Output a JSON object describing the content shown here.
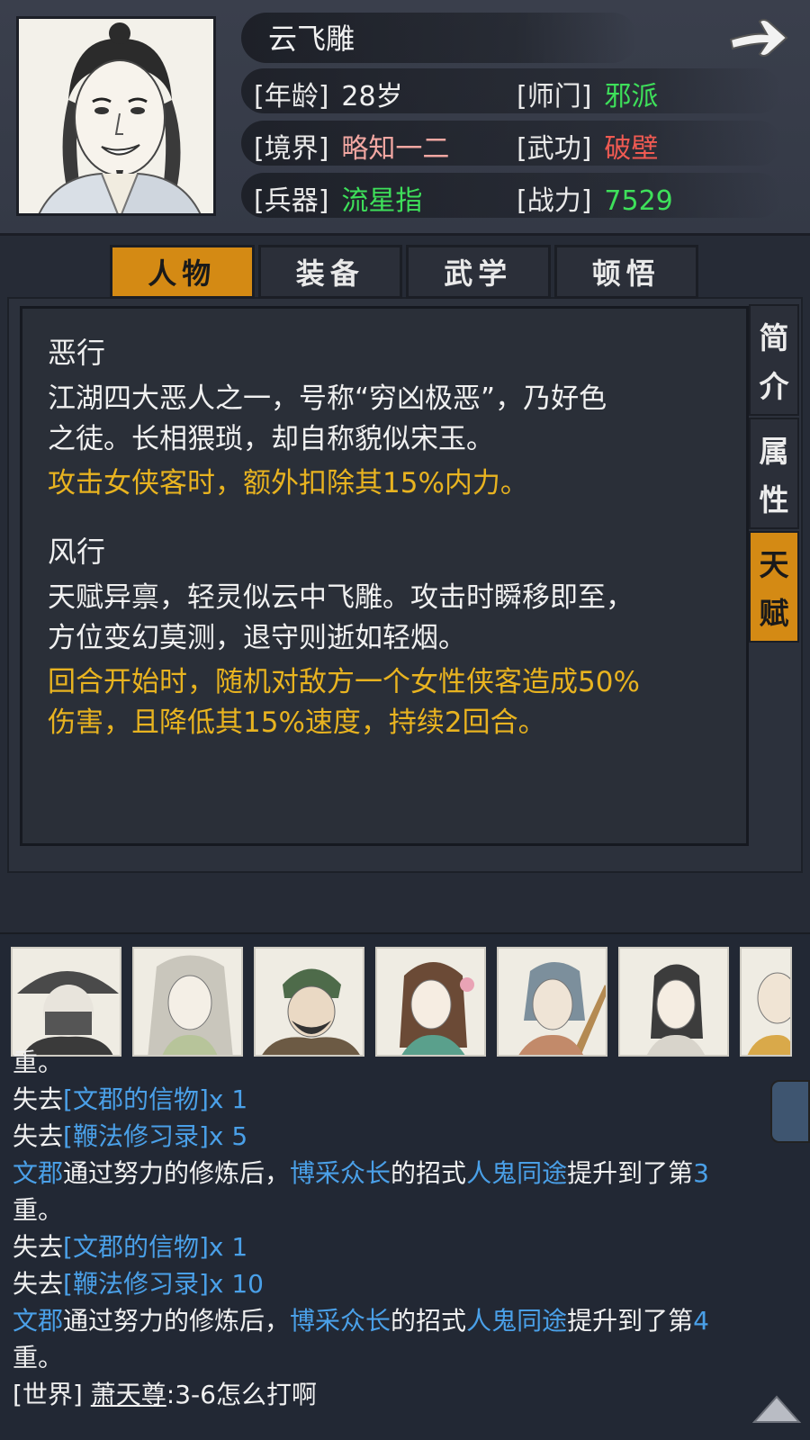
{
  "character": {
    "name": "云飞雕",
    "stats": [
      {
        "label": "[年龄]",
        "value": "28岁",
        "color": "#f0f0f0"
      },
      {
        "label": "[师门]",
        "value": "邪派",
        "color": "#3ee05a"
      },
      {
        "label": "[境界]",
        "value": "略知一二",
        "color": "#f2a7a2"
      },
      {
        "label": "[武功]",
        "value": "破壁",
        "color": "#f05a52"
      },
      {
        "label": "[兵器]",
        "value": "流星指",
        "color": "#3ee05a"
      },
      {
        "label": "[战力]",
        "value": "7529",
        "color": "#3ee05a"
      }
    ]
  },
  "tabs": [
    "人物",
    "装备",
    "武学",
    "顿悟"
  ],
  "side_tabs": [
    {
      "chars": [
        "简",
        "介"
      ]
    },
    {
      "chars": [
        "属",
        "性"
      ]
    },
    {
      "chars": [
        "天",
        "赋"
      ]
    }
  ],
  "talents": [
    {
      "name": "恶行",
      "desc": [
        "江湖四大恶人之一，号称“穷凶极恶”，乃好色",
        "之徒。长相猥琐，却自称貌似宋玉。"
      ],
      "effect": [
        "攻击女侠客时，额外扣除其15%内力。"
      ]
    },
    {
      "name": "风行",
      "desc": [
        "天赋异禀，轻灵似云中飞雕。攻击时瞬移即至，",
        "方位变幻莫测，退守则逝如轻烟。"
      ],
      "effect": [
        "回合开始时，随机对敌方一个女性侠客造成50%",
        "伤害，且降低其15%速度，持续2回合。"
      ]
    }
  ],
  "log": {
    "partial_top": "重。",
    "lose1": {
      "prefix": "失去",
      "item": "[文郡的信物]",
      "qty": "x 1"
    },
    "lose2": {
      "prefix": "失去",
      "item": "[鞭法修习录]",
      "qty": "x 5"
    },
    "train1": {
      "who": "文郡",
      "mid": "通过努力的修炼后，",
      "school": "博采众长",
      "mid2": "的招式",
      "skill": "人鬼同途",
      "tail": "提升到了第",
      "level": "3",
      "end": "重。"
    },
    "lose3": {
      "prefix": "失去",
      "item": "[文郡的信物]",
      "qty": "x 1"
    },
    "lose4": {
      "prefix": "失去",
      "item": "[鞭法修习录]",
      "qty": "x 10"
    },
    "train2": {
      "who": "文郡",
      "mid": "通过努力的修炼后，",
      "school": "博采众长",
      "mid2": "的招式",
      "skill": "人鬼同途",
      "tail": "提升到了第",
      "level": "4",
      "end": "重。"
    },
    "chat": {
      "channel": "[世界]",
      "user": "萧天尊",
      "text": ":3-6怎么打啊"
    }
  }
}
